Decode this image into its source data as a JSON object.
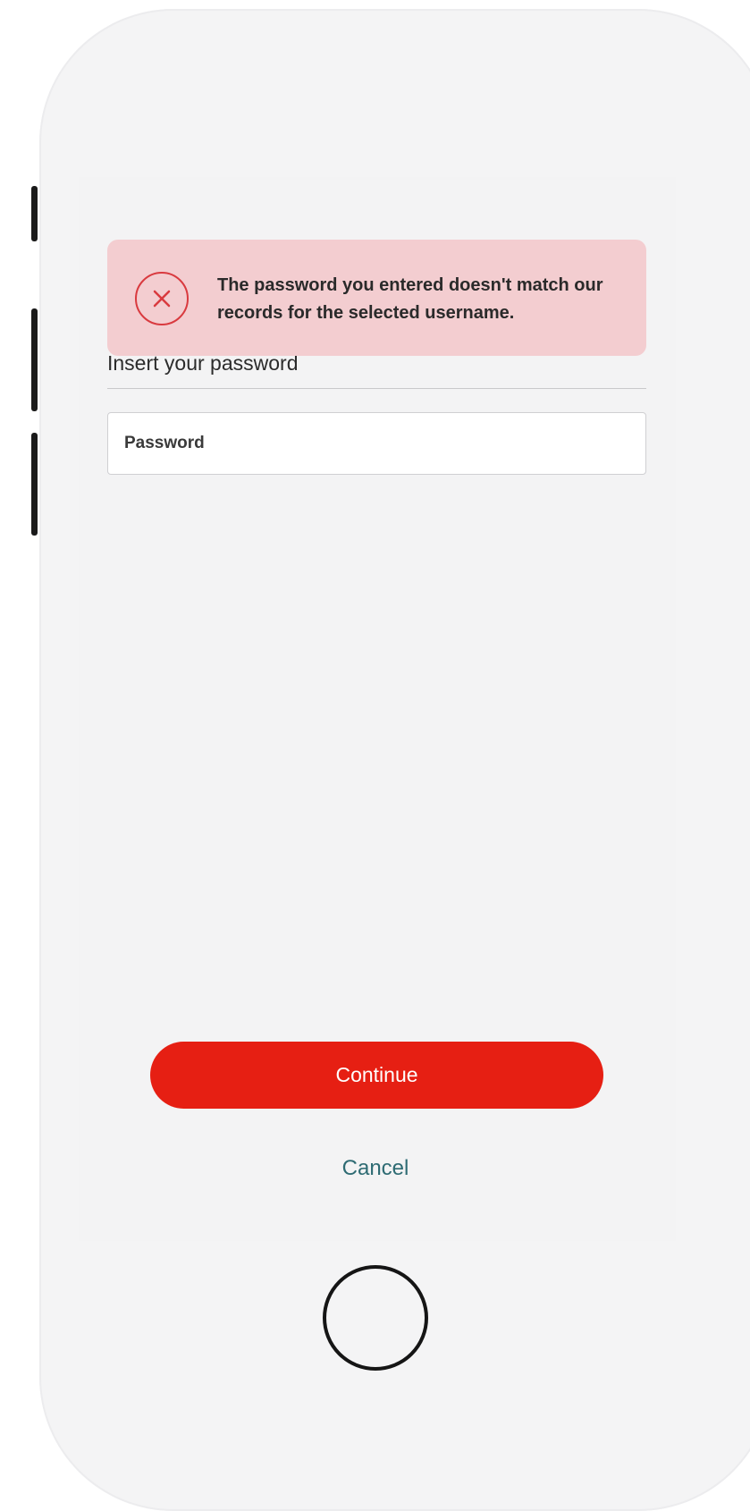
{
  "alert": {
    "icon": "error-circle-x-icon",
    "message": "The password you entered doesn't match our records for the selected username.",
    "background_color": "#f3cdd0",
    "icon_color": "#d93a3f"
  },
  "form": {
    "label": "Insert your password",
    "password_placeholder": "Password",
    "password_value": ""
  },
  "actions": {
    "continue_label": "Continue",
    "cancel_label": "Cancel",
    "continue_color": "#e61f13",
    "cancel_color": "#2e6b73"
  },
  "device": {
    "home_button_icon": "home-button-icon"
  }
}
